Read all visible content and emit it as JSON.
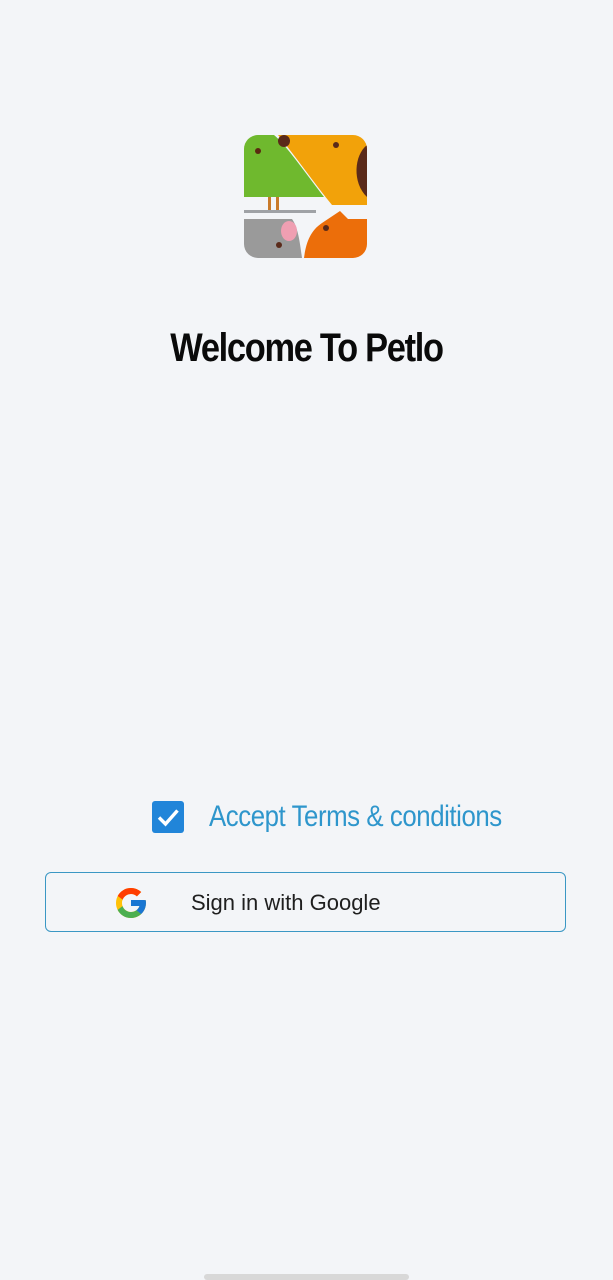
{
  "welcome": {
    "title": "Welcome To Petlo"
  },
  "terms": {
    "label": "Accept Terms & conditions",
    "checked": true
  },
  "google": {
    "label": "Sign in with Google",
    "icon": "google-g-icon"
  },
  "colors": {
    "background": "#f3f5f8",
    "accent": "#2e96cc",
    "checkbox": "#2185d9",
    "button_border": "#3a97c4"
  }
}
